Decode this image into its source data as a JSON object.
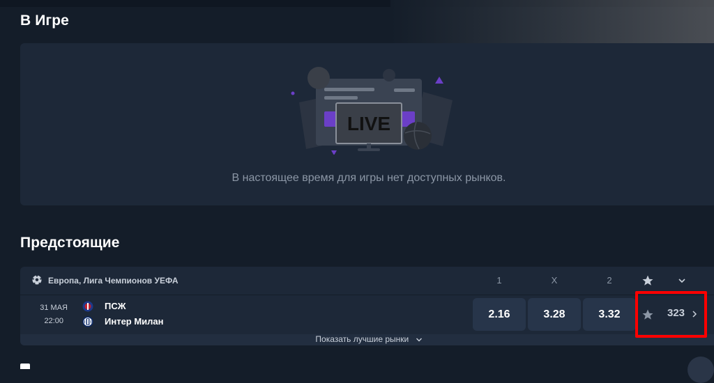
{
  "live": {
    "title": "В Игре",
    "badge": "LIVE",
    "empty_message": "В настоящее время для игры нет доступных рынков."
  },
  "upcoming": {
    "title": "Предстоящие",
    "league": {
      "name": "Европа, Лига Чемпионов УЕФА",
      "columns": [
        "1",
        "X",
        "2"
      ]
    },
    "events": [
      {
        "date": "31 МАЯ",
        "time": "22:00",
        "home_team": "ПСЖ",
        "away_team": "Интер Милан",
        "odds": [
          "2.16",
          "3.28",
          "3.32"
        ],
        "more_markets_count": "323"
      }
    ],
    "show_best_markets": "Показать лучшие рынки"
  },
  "colors": {
    "background": "#141d29",
    "panel": "#1d2838",
    "odd_button": "#27354a",
    "live_accent": "#6b3fc7",
    "highlight": "#ff0000"
  },
  "icons": [
    "soccer-ball-icon",
    "star-icon",
    "chevron-down-icon",
    "chevron-right-icon",
    "psg-badge-icon",
    "inter-badge-icon"
  ]
}
